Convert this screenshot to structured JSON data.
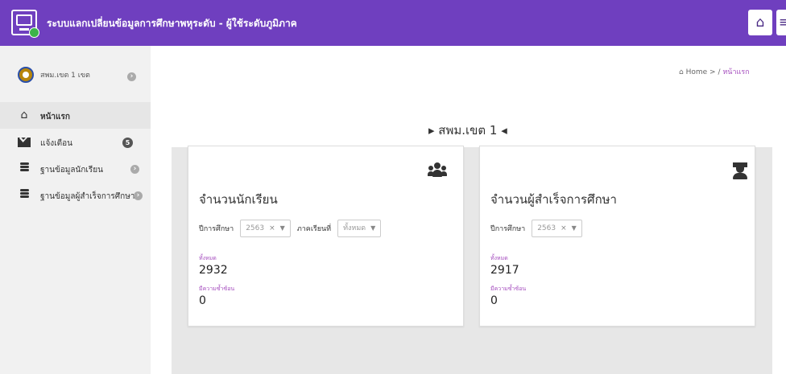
{
  "header": {
    "title": "ระบบแลกเปลี่ยนข้อมูลการศึกษาพหุระดับ - ผู้ใช้ระดับภูมิภาค",
    "home_icon": "home-icon",
    "user_icon": "user-icon"
  },
  "sidebar": {
    "profile_name": "สพม.เขต 1 เขต",
    "items": [
      {
        "label": "หน้าแรก",
        "icon": "home-icon",
        "active": true
      },
      {
        "label": "แจ้งเตือน",
        "icon": "envelope-icon",
        "badge": "5"
      },
      {
        "label": "ฐานข้อมูลนักเรียน",
        "icon": "database-icon"
      },
      {
        "label": "ฐานข้อมูลผู้สำเร็จการศึกษา",
        "icon": "database-icon"
      }
    ]
  },
  "breadcrumb": {
    "home": "Home",
    "separator": ">",
    "slash": "/",
    "current": "หน้าแรก"
  },
  "main": {
    "region_title": "▸ สพม.เขต 1 ◂"
  },
  "cards": {
    "students": {
      "title": "จำนวนนักเรียน",
      "year_label": "ปีการศึกษา",
      "year_value": "2563",
      "term_label": "ภาคเรียนที่",
      "term_value": "ทั้งหมด",
      "total_label": "ทั้งหมด",
      "total_value": "2932",
      "dup_label": "มีความซ้ำซ้อน",
      "dup_value": "0",
      "icon": "users-icon"
    },
    "graduates": {
      "title": "จำนวนผู้สำเร็จการศึกษา",
      "year_label": "ปีการศึกษา",
      "year_value": "2563",
      "total_label": "ทั้งหมด",
      "total_value": "2917",
      "dup_label": "มีความซ้ำซ้อน",
      "dup_value": "0",
      "icon": "graduate-icon"
    }
  },
  "colors": {
    "header": "#6f3fbf",
    "accent": "#a64fbf",
    "sidebar": "#f1f1f1",
    "panel": "#e7e7e7"
  }
}
